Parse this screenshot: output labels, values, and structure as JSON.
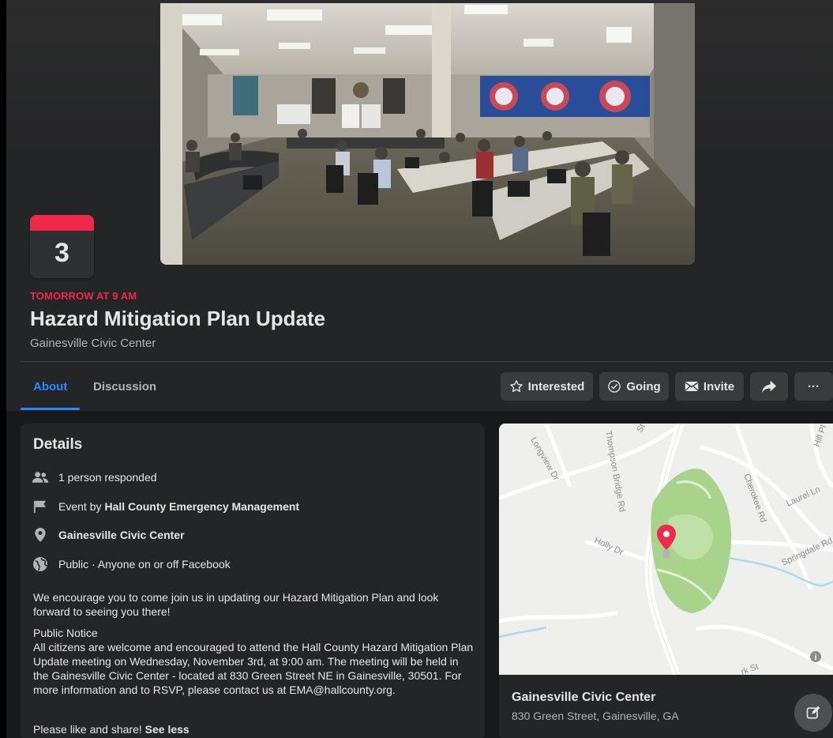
{
  "event": {
    "date_day": "3",
    "when": "TOMORROW AT 9 AM",
    "title": "Hazard Mitigation Plan Update",
    "venue": "Gainesville Civic Center"
  },
  "tabs": [
    {
      "label": "About",
      "active": true
    },
    {
      "label": "Discussion",
      "active": false
    }
  ],
  "actions": {
    "interested": "Interested",
    "going": "Going",
    "invite": "Invite",
    "share_icon": "share-arrow-icon",
    "more": "···"
  },
  "details": {
    "heading": "Details",
    "responded": "1 person responded",
    "event_by_prefix": "Event by ",
    "event_by_org": "Hall County Emergency Management",
    "location": "Gainesville Civic Center",
    "privacy": "Public · Anyone on or off Facebook",
    "intro": "We encourage you to come join us in updating our Hazard Mitigation Plan and look forward to seeing you there!",
    "notice_heading": "Public Notice",
    "notice_body": "All citizens are welcome and encouraged to attend the Hall County Hazard Mitigation Plan Update meeting on Wednesday, November 3rd, at 9:00 am. The meeting will be held in the Gainesville Civic Center - located at 830 Green Street NE in Gainesville, 30501. For more information and to RSVP, please contact us at EMA@hallcounty.org.",
    "closing": "Please like and share! ",
    "see_less": "See less"
  },
  "map": {
    "streets": [
      "Longview Dr",
      "Thompson Bridge Rd",
      "St",
      "Cherokee Rd",
      "Hill Pl",
      "Laurel Ln",
      "Holly Dr",
      "Springdale Rd",
      "rk St"
    ],
    "place_name": "Gainesville Civic Center",
    "address": "830 Green Street, Gainesville, GA",
    "info_icon": "i"
  },
  "colors": {
    "accent": "#2d88ff",
    "date_red": "#f02849",
    "card_bg": "#242526",
    "page_bg": "#18191a",
    "button_bg": "#3a3b3c",
    "pin": "#f02849",
    "park": "#a8d38b"
  }
}
